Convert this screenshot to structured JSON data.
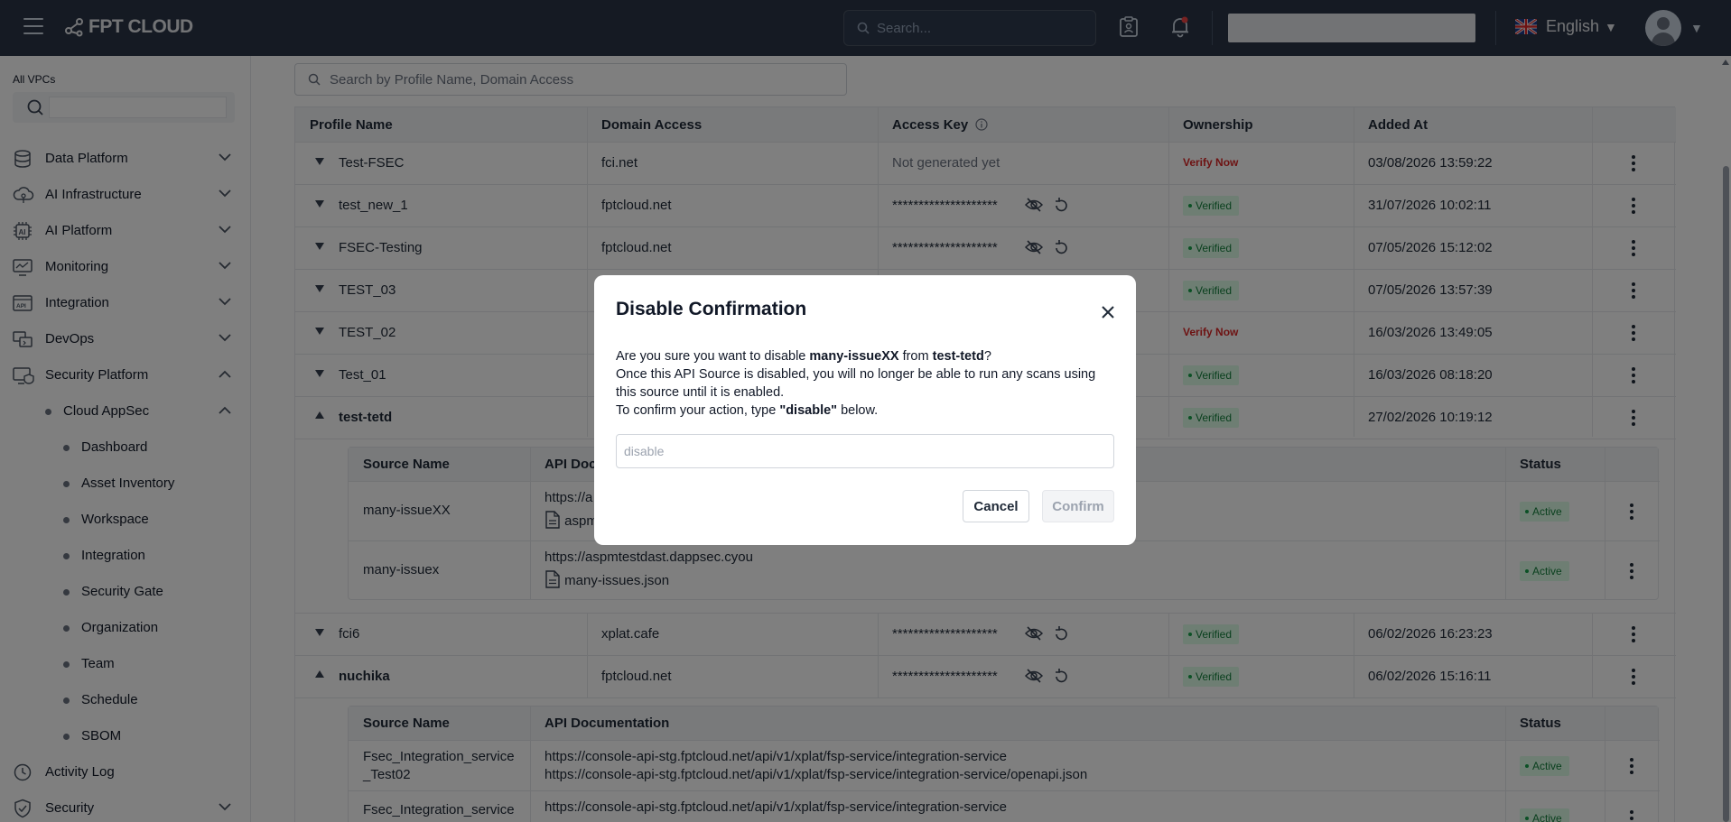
{
  "header": {
    "logo_text": "FPT CLOUD",
    "search_placeholder": "Search...",
    "language": "English"
  },
  "sidebar": {
    "vpc_label": "All VPCs",
    "items": [
      {
        "label": "Data Platform",
        "icon": "database-icon"
      },
      {
        "label": "AI Infrastructure",
        "icon": "ai-infrastructure-icon"
      },
      {
        "label": "AI Platform",
        "icon": "ai-chip-icon"
      },
      {
        "label": "Monitoring",
        "icon": "monitor-icon"
      },
      {
        "label": "Integration",
        "icon": "api-icon"
      },
      {
        "label": "DevOps",
        "icon": "devops-icon"
      },
      {
        "label": "Security Platform",
        "icon": "security-platform-icon"
      }
    ],
    "cloud_appsec": "Cloud AppSec",
    "sub_items": [
      "Dashboard",
      "Asset Inventory",
      "Workspace",
      "Integration",
      "Security Gate",
      "Organization",
      "Team",
      "Schedule",
      "SBOM"
    ],
    "activity_log": "Activity Log",
    "security": "Security"
  },
  "main": {
    "search_placeholder": "Search by Profile Name, Domain Access",
    "columns": [
      "Profile Name",
      "Domain Access",
      "Access Key",
      "Ownership",
      "Added At"
    ],
    "rows": [
      {
        "name": "Test-FSEC",
        "domain": "fci.net",
        "key": "Not generated yet",
        "ownership": "Verify Now",
        "added": "03/08/2026 13:59:22"
      },
      {
        "name": "test_new_1",
        "domain": "fptcloud.net",
        "key": "********************",
        "ownership": "Verified",
        "added": "31/07/2026 10:02:11"
      },
      {
        "name": "FSEC-Testing",
        "domain": "fptcloud.net",
        "key": "********************",
        "ownership": "Verified",
        "added": "07/05/2026 15:12:02"
      },
      {
        "name": "TEST_03",
        "domain": "",
        "key": "",
        "ownership": "Verified",
        "added": "07/05/2026 13:57:39"
      },
      {
        "name": "TEST_02",
        "domain": "",
        "key": "",
        "ownership": "Verify Now",
        "added": "16/03/2026 13:49:05"
      },
      {
        "name": "Test_01",
        "domain": "",
        "key": "",
        "ownership": "Verified",
        "added": "16/03/2026 08:18:20"
      },
      {
        "name": "test-tetd",
        "domain": "",
        "key": "",
        "ownership": "Verified",
        "added": "27/02/2026 10:19:12"
      }
    ],
    "sub1": {
      "columns": [
        "Source Name",
        "API Docu",
        "Status"
      ],
      "rows": [
        {
          "name": "many-issueXX",
          "url": "https://a",
          "file": "aspm",
          "status": "Active"
        },
        {
          "name": "many-issuex",
          "url": "https://aspmtestdast.dappsec.cyou",
          "file": "many-issues.json",
          "status": "Active"
        }
      ]
    },
    "rows2": [
      {
        "name": "fci6",
        "domain": "xplat.cafe",
        "key": "********************",
        "ownership": "Verified",
        "added": "06/02/2026 16:23:23"
      },
      {
        "name": "nuchika",
        "domain": "fptcloud.net",
        "key": "********************",
        "ownership": "Verified",
        "added": "06/02/2026 15:16:11"
      }
    ],
    "sub2": {
      "columns": [
        "Source Name",
        "API Documentation",
        "Status"
      ],
      "rows": [
        {
          "name_line1": "Fsec_Integration_service",
          "name_line2": "_Test02",
          "url1": "https://console-api-stg.fptcloud.net/api/v1/xplat/fsp-service/integration-service",
          "url2": "https://console-api-stg.fptcloud.net/api/v1/xplat/fsp-service/integration-service/openapi.json",
          "status": "Active"
        },
        {
          "name_line1": "Fsec_Integration_service",
          "url1": "https://console-api-stg.fptcloud.net/api/v1/xplat/fsp-service/integration-service",
          "status": "Active"
        }
      ]
    }
  },
  "modal": {
    "title": "Disable Confirmation",
    "line1_pre": "Are you sure you want to disable ",
    "line1_source": "many-issueXX",
    "line1_mid": " from ",
    "line1_profile": "test-tetd",
    "line1_end": "?",
    "line2": "Once this API Source is disabled, you will no longer be able to run any scans using this source until it is enabled.",
    "line3_pre": "To confirm your action, type ",
    "line3_word": "\"disable\"",
    "line3_end": " below.",
    "input_placeholder": "disable",
    "cancel_label": "Cancel",
    "confirm_label": "Confirm"
  },
  "colors": {
    "topbar": "#2a3547",
    "verified_bg": "#dcfce7",
    "verified_text": "#15803d",
    "verify_now": "#dc2626"
  }
}
